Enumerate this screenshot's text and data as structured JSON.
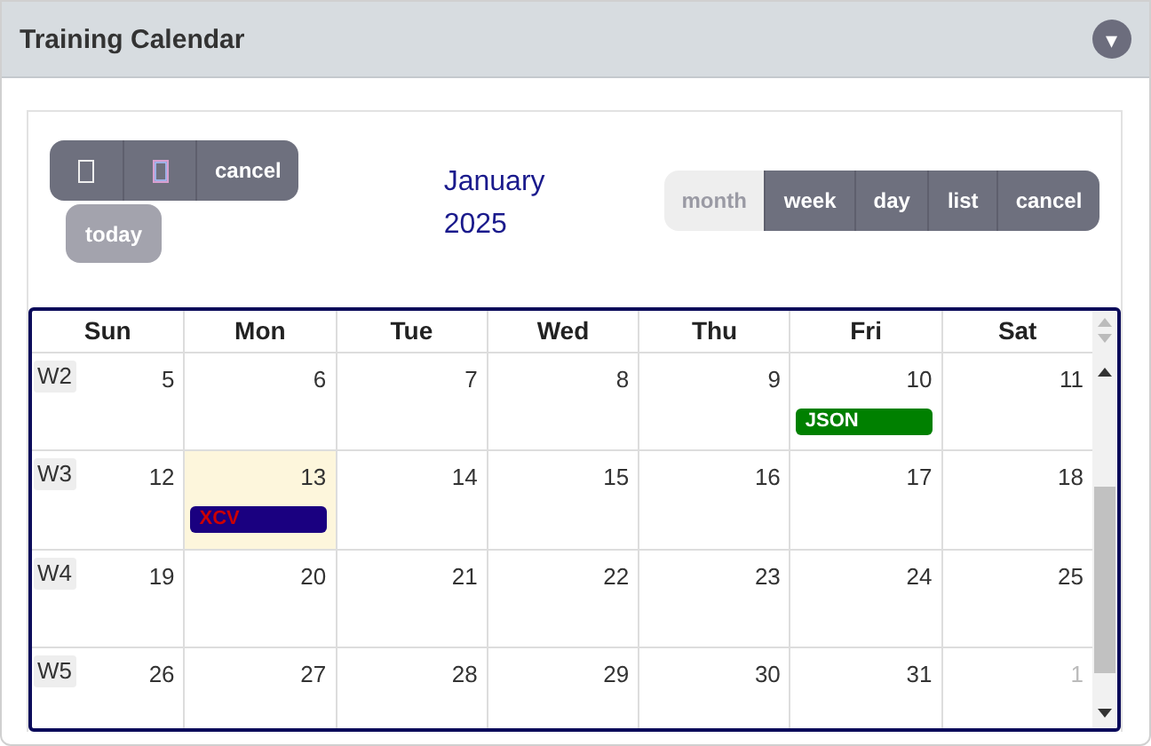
{
  "panel": {
    "title": "Training Calendar",
    "collapse_icon": "▾"
  },
  "toolbar": {
    "nav_buttons": [
      {
        "kind": "prev"
      },
      {
        "kind": "next"
      },
      {
        "kind": "text",
        "label": "cancel"
      }
    ],
    "today": {
      "label": "today",
      "disabled": true
    },
    "title_month": "January",
    "title_year": "2025",
    "views": [
      {
        "label": "month",
        "selected": true
      },
      {
        "label": "week",
        "selected": false
      },
      {
        "label": "day",
        "selected": false
      },
      {
        "label": "list",
        "selected": false
      },
      {
        "label": "cancel",
        "selected": false
      }
    ]
  },
  "calendar": {
    "columns": [
      "Sun",
      "Mon",
      "Tue",
      "Wed",
      "Thu",
      "Fri",
      "Sat"
    ],
    "weeks": [
      {
        "label": "W2",
        "days": [
          {
            "day": "5"
          },
          {
            "day": "6"
          },
          {
            "day": "7"
          },
          {
            "day": "8"
          },
          {
            "day": "9"
          },
          {
            "day": "10",
            "events": [
              {
                "title": "JSON",
                "color": "#008000",
                "kind": "plain"
              }
            ]
          },
          {
            "day": "11"
          }
        ]
      },
      {
        "label": "W3",
        "days": [
          {
            "day": "12"
          },
          {
            "day": "13",
            "today": true,
            "events": [
              {
                "title": "XCV",
                "color": "#1a0080",
                "kind": "alert"
              }
            ]
          },
          {
            "day": "14"
          },
          {
            "day": "15"
          },
          {
            "day": "16"
          },
          {
            "day": "17"
          },
          {
            "day": "18"
          }
        ]
      },
      {
        "label": "W4",
        "days": [
          {
            "day": "19"
          },
          {
            "day": "20"
          },
          {
            "day": "21"
          },
          {
            "day": "22"
          },
          {
            "day": "23"
          },
          {
            "day": "24"
          },
          {
            "day": "25"
          }
        ]
      },
      {
        "label": "W5",
        "days": [
          {
            "day": "26"
          },
          {
            "day": "27"
          },
          {
            "day": "28"
          },
          {
            "day": "29"
          },
          {
            "day": "30"
          },
          {
            "day": "31"
          },
          {
            "day": "1",
            "other_month": true
          }
        ]
      }
    ]
  }
}
